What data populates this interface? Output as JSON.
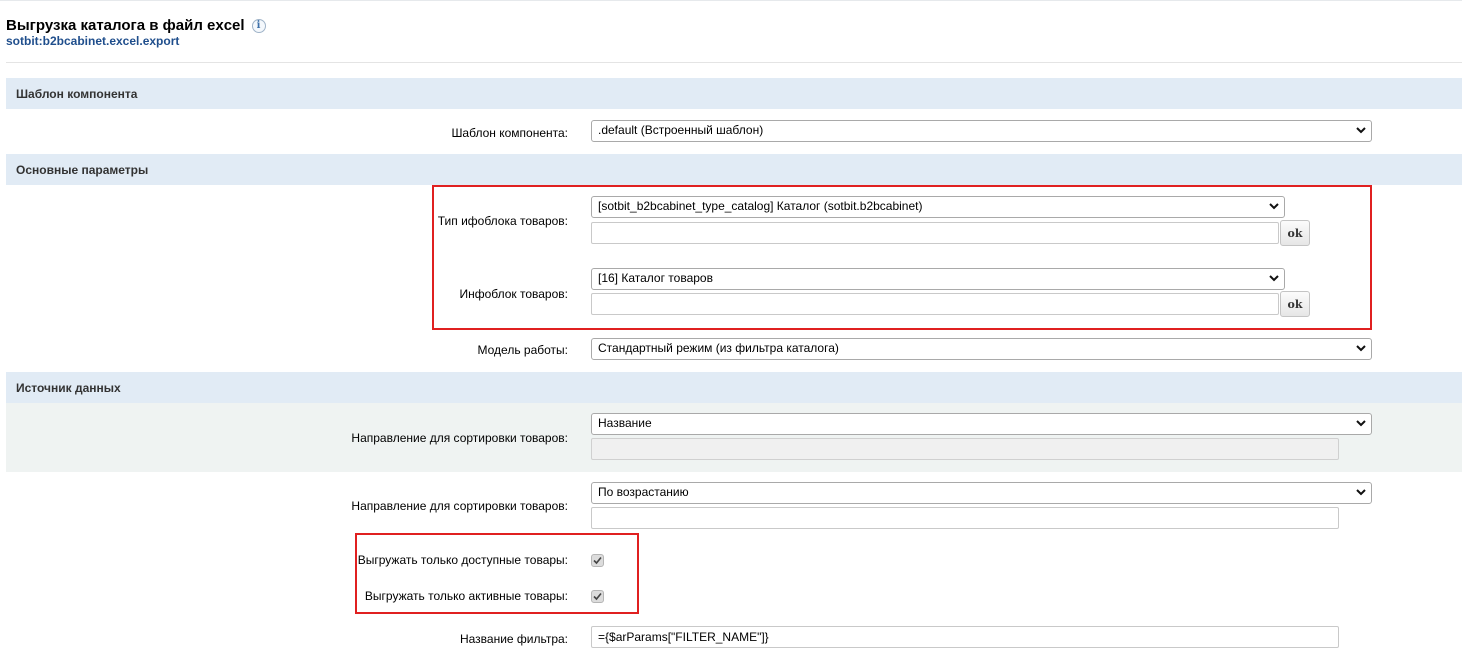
{
  "header": {
    "title": "Выгрузка каталога в файл excel",
    "info_icon_glyph": "i",
    "component_code": "sotbit:b2bcabinet.excel.export"
  },
  "sections": {
    "template": "Шаблон компонента",
    "main": "Основные параметры",
    "source": "Источник данных"
  },
  "fields": {
    "component_template": {
      "label": "Шаблон компонента:",
      "value": ".default (Встроенный шаблон)"
    },
    "iblock_type": {
      "label": "Тип ифоблока товаров:",
      "value": "[sotbit_b2bcabinet_type_catalog] Каталог (sotbit.b2bcabinet)",
      "custom_value": "",
      "ok": "ok"
    },
    "iblock": {
      "label": "Инфоблок товаров:",
      "value": "[16] Каталог товаров",
      "custom_value": "",
      "ok": "ok"
    },
    "work_model": {
      "label": "Модель работы:",
      "value": "Стандартный режим (из фильтра каталога)"
    },
    "sort_field": {
      "label": "Направление для сортировки товаров:",
      "value": "Название",
      "custom_value": ""
    },
    "sort_order": {
      "label": "Направление для сортировки товаров:",
      "value": "По возрастанию",
      "custom_value": ""
    },
    "only_available": {
      "label": "Выгружать только доступные товары:",
      "checked": true
    },
    "only_active": {
      "label": "Выгружать только активные товары:",
      "checked": true
    },
    "filter_name": {
      "label": "Название фильтра:",
      "value": "={$arParams[\"FILTER_NAME\"]}"
    }
  },
  "icons": {
    "select_arrow": "chevron-down-icon",
    "check": "checkmark-icon",
    "info": "info-icon"
  },
  "colors": {
    "section_bg": "#e1ebf5",
    "highlight_border": "#e02020",
    "subtitle": "#1f4e8c"
  }
}
